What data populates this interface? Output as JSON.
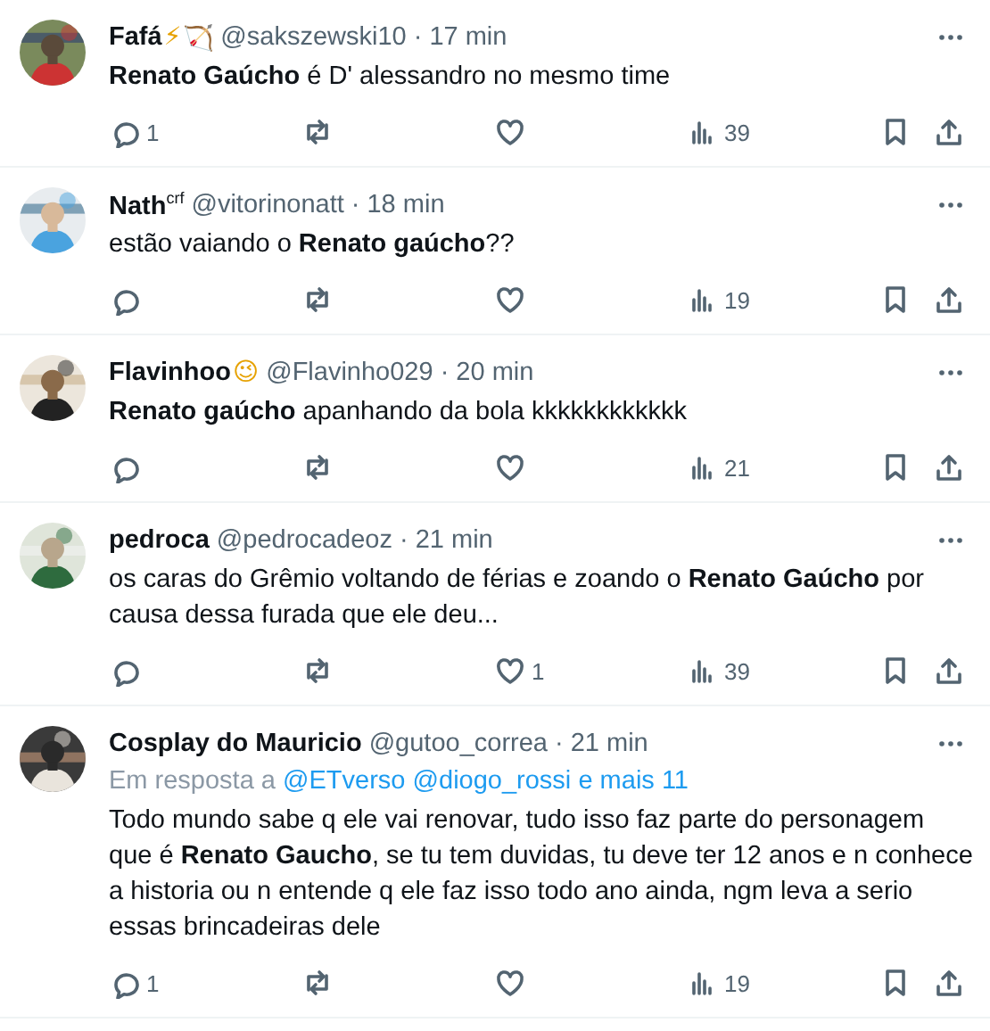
{
  "tweets": [
    {
      "name": "Fafá",
      "name_emojis": [
        "⚡",
        "🏹"
      ],
      "handle": "@sakszewski10",
      "separator": "·",
      "time": "17 min",
      "text": "**Renato Gaúcho** é D' alessandro no mesmo time",
      "stats": {
        "replies": "1",
        "views": "39"
      }
    },
    {
      "name": "Nath$^{crf}$",
      "handle": "@vitorinonatt",
      "separator": "·",
      "time": "18 min",
      "text": "estão vaiando o **Renato gaúcho**??",
      "stats": {
        "views": "19"
      }
    },
    {
      "name": "Flavinhoo",
      "name_emojis": [
        "😉"
      ],
      "handle": "@Flavinho029",
      "separator": "·",
      "time": "20 min",
      "text": "**Renato gaúcho** apanhando da bola kkkkkkkkkkkk",
      "stats": {
        "views": "21"
      }
    },
    {
      "name": "pedroca",
      "handle": "@pedrocadeoz",
      "separator": "·",
      "time": "21 min",
      "text": "os caras do Grêmio voltando de férias e zoando o **Renato Gaúcho** por causa dessa furada que ele deu...",
      "stats": {
        "likes": "1",
        "views": "39"
      }
    },
    {
      "name": "Cosplay do Mauricio",
      "handle": "@gutoo_correa",
      "separator": "·",
      "time": "21 min",
      "reply_to": {
        "prefix": "Em resposta a",
        "links": [
          "@ETverso",
          "@diogo_rossi",
          "e mais 11"
        ]
      },
      "text": "Todo mundo sabe q ele vai renovar, tudo isso faz parte do personagem que é **Renato Gaucho**, se tu tem duvidas, tu deve ter 12 anos e n conhece a historia ou n entende q ele faz isso todo ano ainda, ngm leva a serio essas brincadeiras dele",
      "stats": {
        "replies": "1",
        "views": "19"
      }
    }
  ]
}
